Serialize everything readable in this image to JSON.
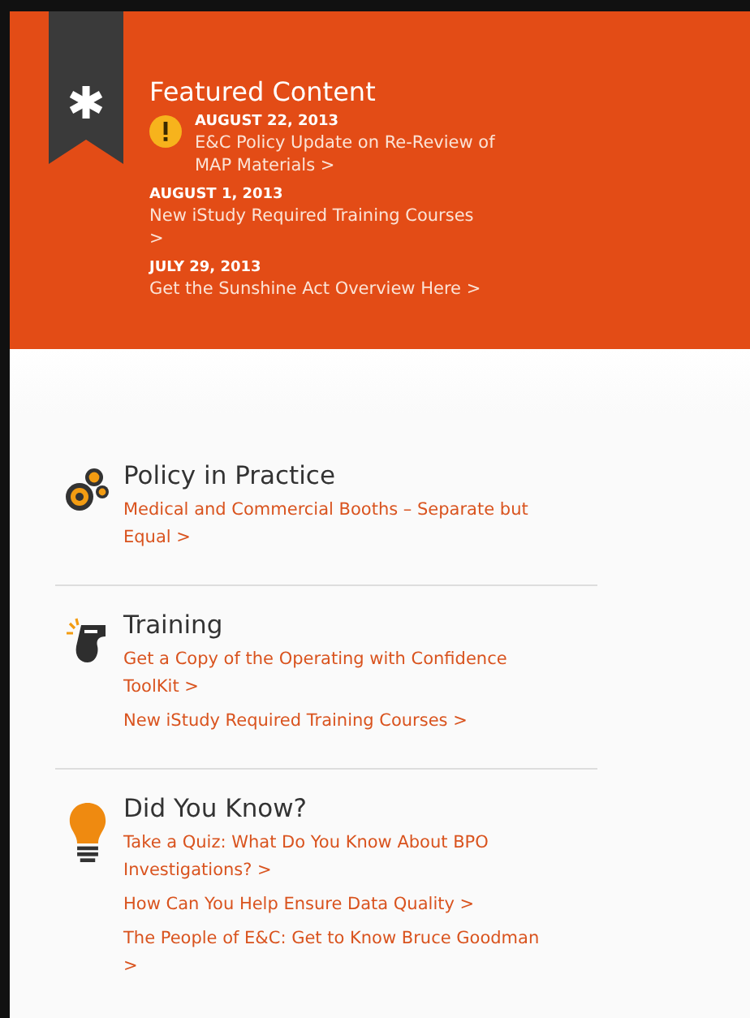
{
  "featured": {
    "title": "Featured Content",
    "items": [
      {
        "kind": "alert",
        "date": "AUGUST 22, 2013",
        "link": "E&C Policy Update on Re-Review of MAP Materials >"
      },
      {
        "kind": "plain",
        "date": "AUGUST 1, 2013",
        "link": "New iStudy Required Training Courses >"
      },
      {
        "kind": "plain",
        "date": "JULY 29, 2013",
        "link": "Get the Sunshine Act Overview Here >"
      }
    ]
  },
  "sections": [
    {
      "kind": "gears",
      "title": "Policy in Practice",
      "links": [
        "Medical and Commercial Booths – Separate but Equal >"
      ]
    },
    {
      "kind": "whistle",
      "title": "Training",
      "links": [
        "Get a Copy of the Operating with Confidence ToolKit >",
        "New iStudy Required Training Courses >"
      ]
    },
    {
      "kind": "bulb",
      "title": "Did You Know?",
      "links": [
        "Take a Quiz: What Do You Know About BPO Investigations? >",
        "How Can You Help Ensure Data Quality >",
        "The People of E&C: Get to Know Bruce Goodman >"
      ]
    }
  ]
}
